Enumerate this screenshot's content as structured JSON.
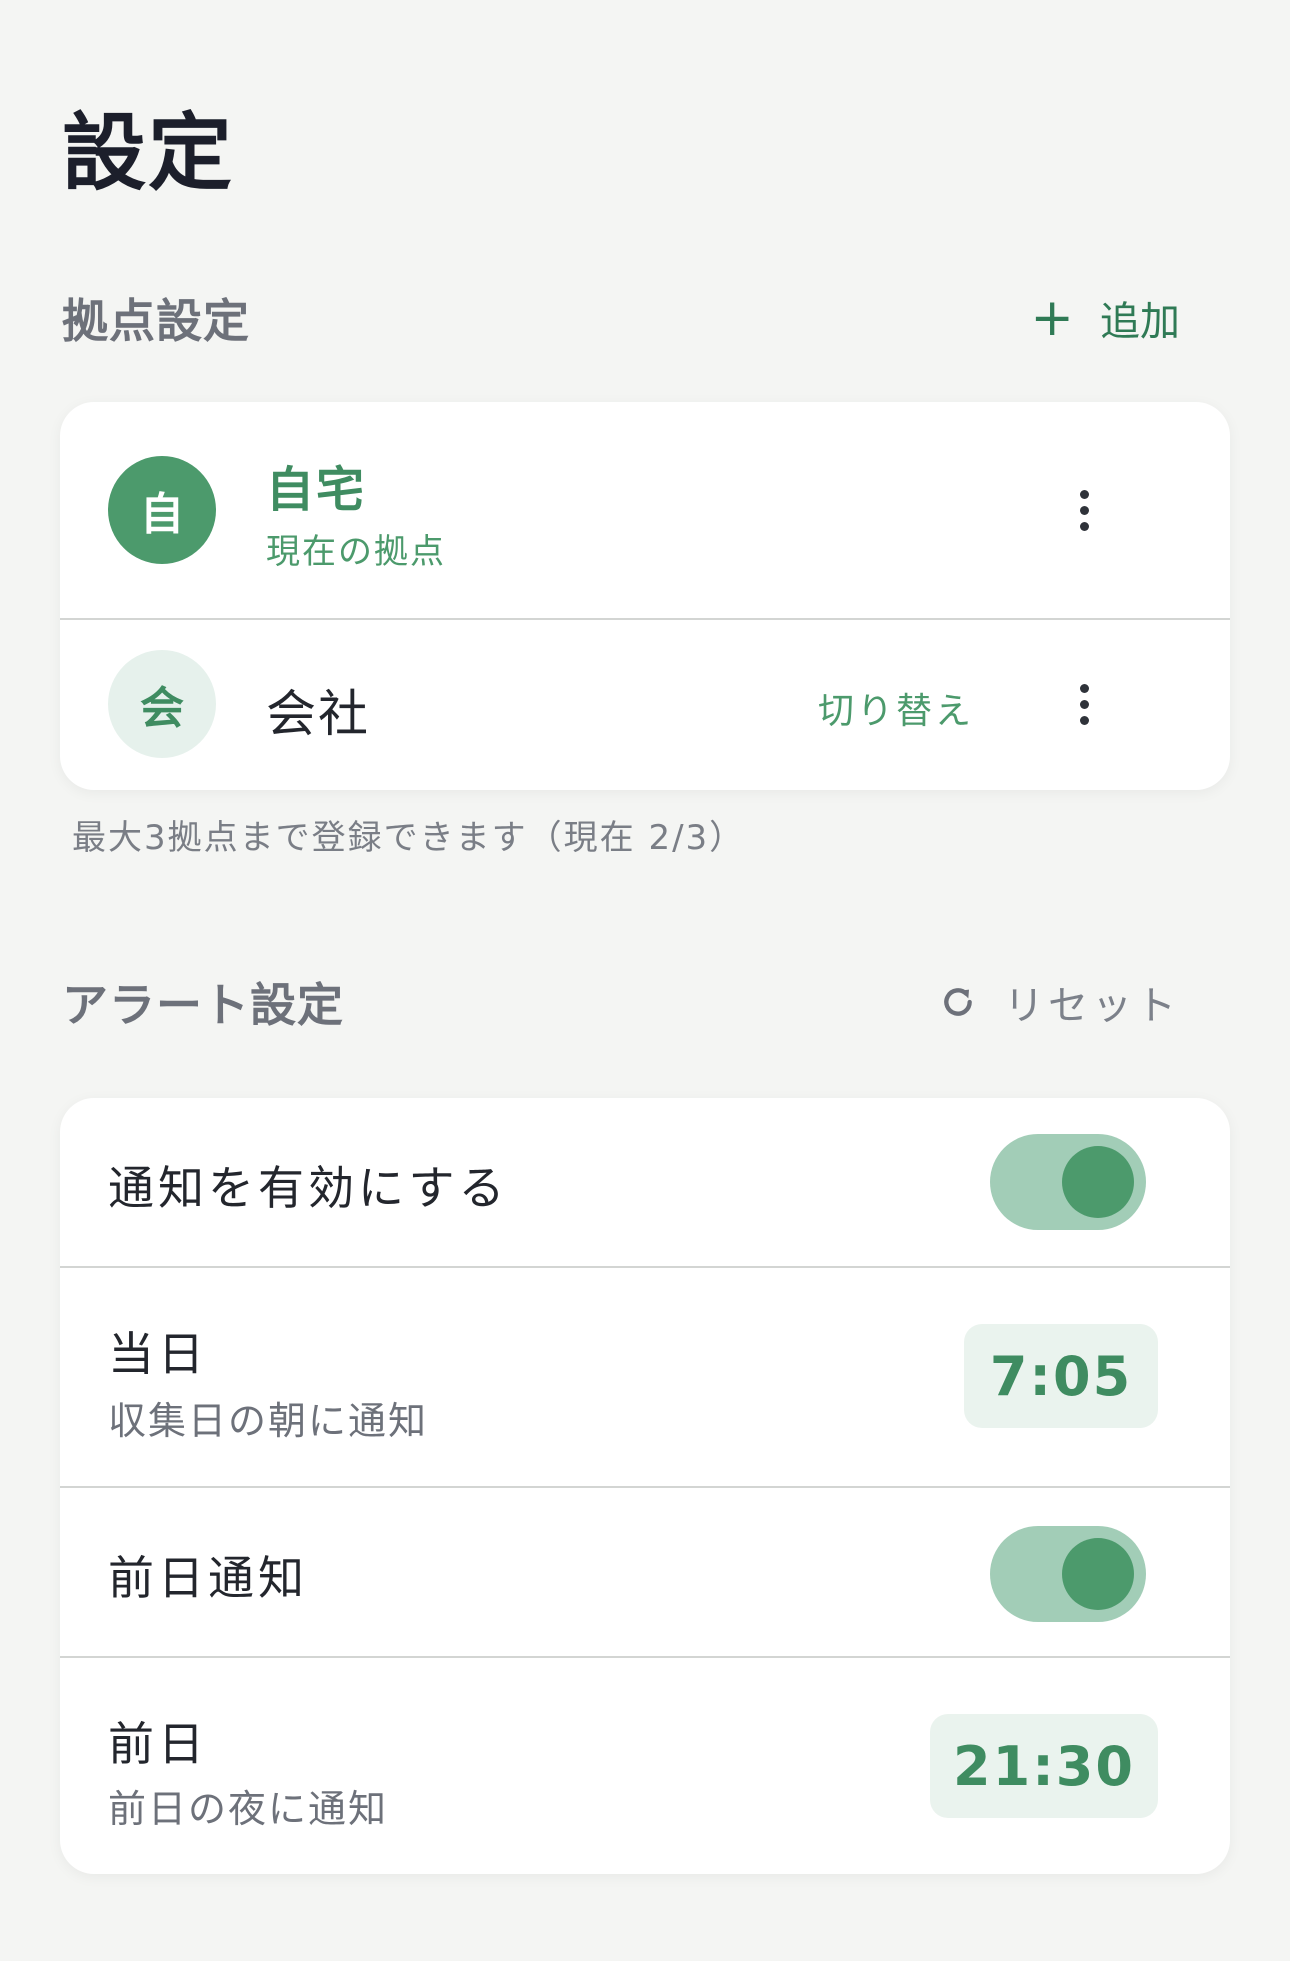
{
  "page": {
    "title": "設定"
  },
  "locations": {
    "title": "拠点設定",
    "add_label": "追加",
    "add_icon": "plus-icon",
    "items": [
      {
        "initial": "自",
        "name": "自宅",
        "status": "現在の拠点",
        "active": true
      },
      {
        "initial": "会",
        "name": "会社",
        "action": "切り替え",
        "active": false
      }
    ],
    "note": "最大3拠点まで登録できます（現在 2/3）"
  },
  "alerts": {
    "title": "アラート設定",
    "reset_label": "リセット",
    "reset_icon": "refresh-icon",
    "enable": {
      "label": "通知を有効にする",
      "on": true
    },
    "same_day": {
      "label": "当日",
      "sub": "収集日の朝に通知",
      "time": "7:05"
    },
    "prev_toggle": {
      "label": "前日通知",
      "on": true
    },
    "prev_day": {
      "label": "前日",
      "sub": "前日の夜に通知",
      "time": "21:30"
    }
  },
  "colors": {
    "accent": "#4c9a6c",
    "accent_dark": "#3f8c61",
    "toggle_track": "#a2cdb7",
    "chip_bg": "#eaf3ee",
    "background": "#f4f5f3"
  }
}
